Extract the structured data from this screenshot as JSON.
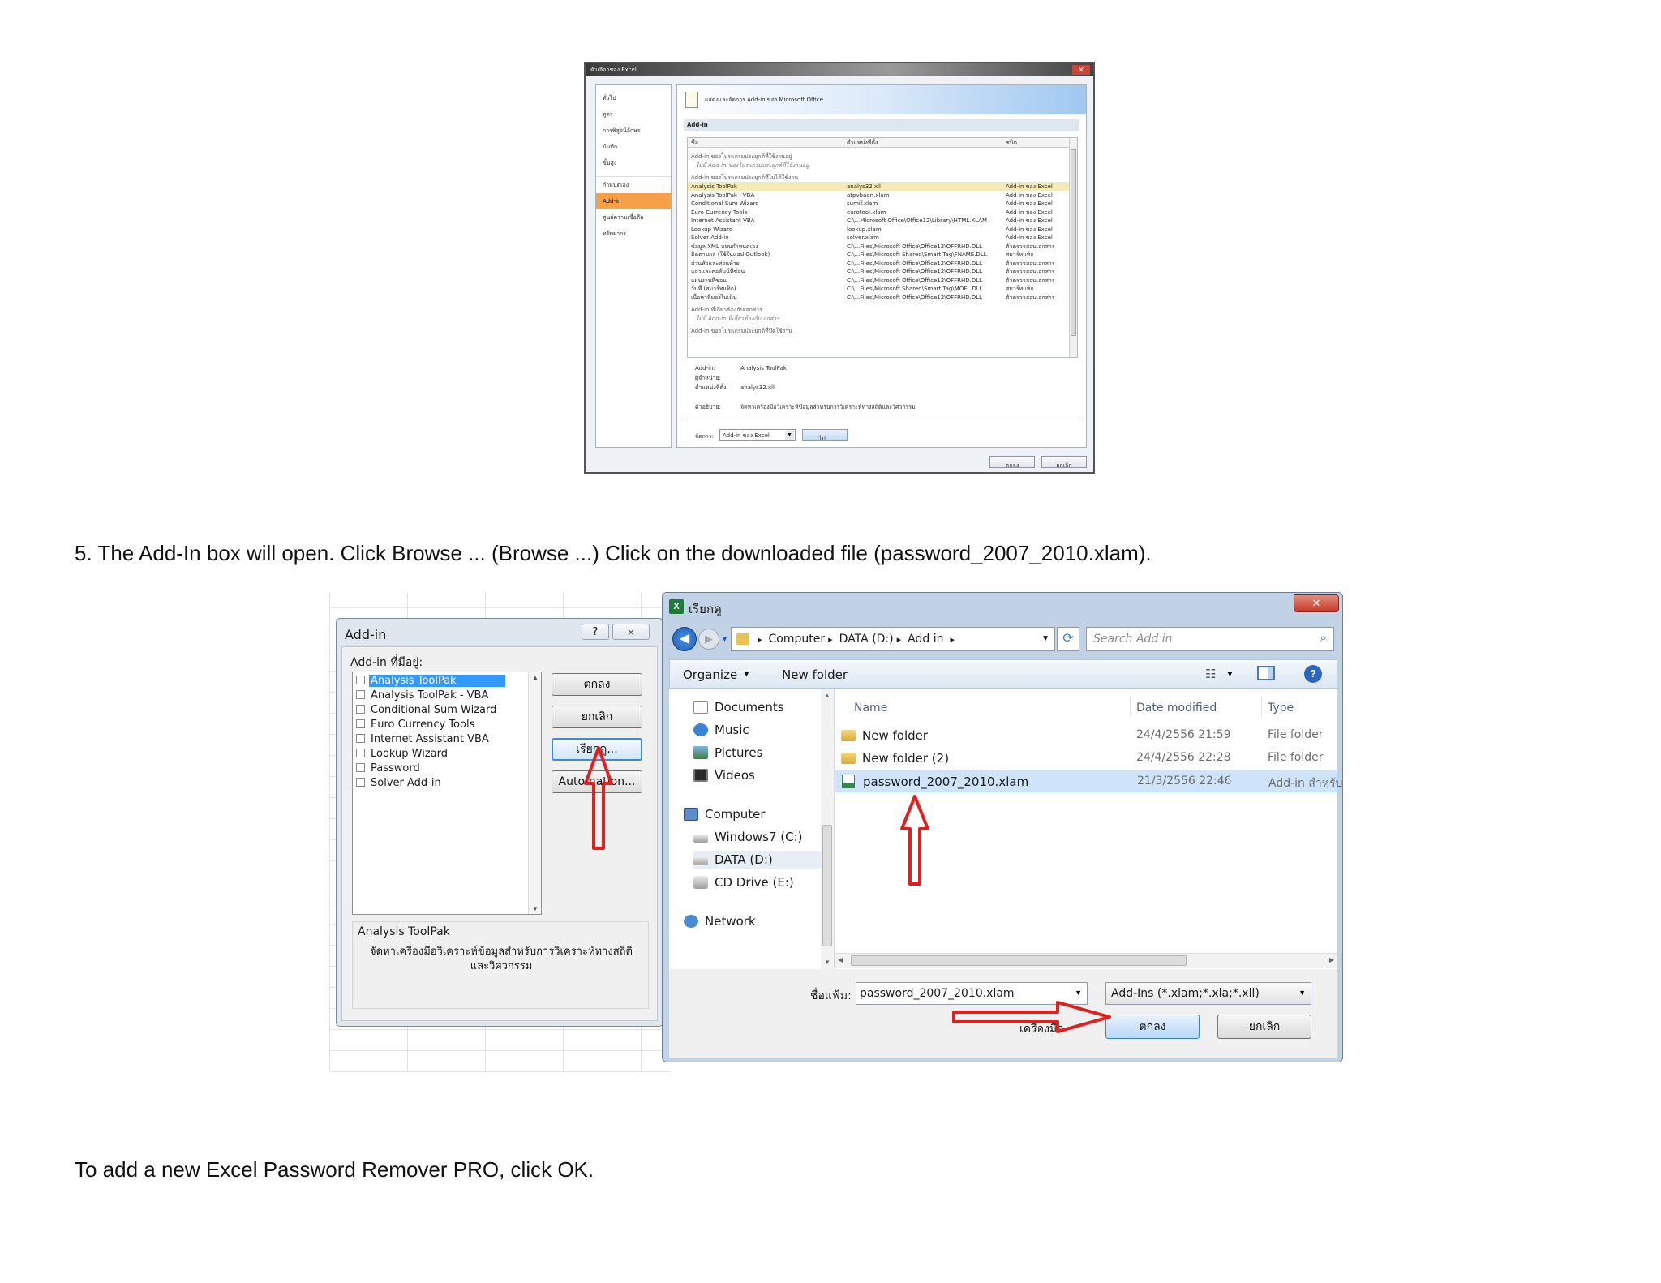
{
  "fig1": {
    "window_title": "ตัวเลือกของ Excel",
    "header_text": "แสดงและจัดการ Add-in ของ Microsoft Office",
    "section_title": "Add-in",
    "nav_items": [
      "ทั่วไป",
      "สูตร",
      "การพิสูจน์อักษร",
      "บันทึก",
      "ขั้นสูง",
      "กำหนดเอง",
      "Add-in",
      "ศูนย์ความเชื่อถือ",
      "ทรัพยากร"
    ],
    "col_headers": [
      "ชื่อ",
      "ตำแหน่งที่ตั้ง",
      "ชนิด"
    ],
    "groups": [
      {
        "title": "Add-in ของโปรแกรมประยุกต์ที่ใช้งานอยู่",
        "note": "ไม่มี Add-in ของโปรแกรมประยุกต์ที่ใช้งานอยู่",
        "rows": []
      },
      {
        "title": "Add-in ของโปรแกรมประยุกต์ที่ไม่ได้ใช้งาน",
        "note": "",
        "rows": [
          {
            "name": "Analysis ToolPak",
            "loc": "analys32.xll",
            "type": "Add-in ของ Excel"
          },
          {
            "name": "Analysis ToolPak - VBA",
            "loc": "atpvbaen.xlam",
            "type": "Add-in ของ Excel"
          },
          {
            "name": "Conditional Sum Wizard",
            "loc": "sumif.xlam",
            "type": "Add-in ของ Excel"
          },
          {
            "name": "Euro Currency Tools",
            "loc": "eurotool.xlam",
            "type": "Add-in ของ Excel"
          },
          {
            "name": "Internet Assistant VBA",
            "loc": "C:\\...Microsoft Office\\Office12\\Library\\HTML.XLAM",
            "type": "Add-in ของ Excel"
          },
          {
            "name": "Lookup Wizard",
            "loc": "lookup.xlam",
            "type": "Add-in ของ Excel"
          },
          {
            "name": "Solver Add-in",
            "loc": "solver.xlam",
            "type": "Add-in ของ Excel"
          },
          {
            "name": "ข้อมูล XML แบบกำหนดเอง",
            "loc": "C:\\...Files\\Microsoft Office\\Office12\\OFFRHD.DLL",
            "type": "ตัวตรวจสอบเอกสาร"
          },
          {
            "name": "ติดตามผล (ใช้ในแอป Outlook)",
            "loc": "C:\\...Files\\Microsoft Shared\\Smart Tag\\FNAME.DLL",
            "type": "สมาร์ทแท็ก"
          },
          {
            "name": "ส่วนหัวและส่วนท้าย",
            "loc": "C:\\...Files\\Microsoft Office\\Office12\\OFFRHD.DLL",
            "type": "ตัวตรวจสอบเอกสาร"
          },
          {
            "name": "แถวและคอลัมน์ที่ซ่อน",
            "loc": "C:\\...Files\\Microsoft Office\\Office12\\OFFRHD.DLL",
            "type": "ตัวตรวจสอบเอกสาร"
          },
          {
            "name": "แผ่นงานที่ซ่อน",
            "loc": "C:\\...Files\\Microsoft Office\\Office12\\OFFRHD.DLL",
            "type": "ตัวตรวจสอบเอกสาร"
          },
          {
            "name": "วันที่ (สมาร์ทแท็ก)",
            "loc": "C:\\...Files\\Microsoft Shared\\Smart Tag\\MOFL.DLL",
            "type": "สมาร์ทแท็ก"
          },
          {
            "name": "เนื้อหาที่มองไม่เห็น",
            "loc": "C:\\...Files\\Microsoft Office\\Office12\\OFFRHD.DLL",
            "type": "ตัวตรวจสอบเอกสาร"
          }
        ]
      },
      {
        "title": "Add-in ที่เกี่ยวข้องกับเอกสาร",
        "note": "ไม่มี Add-in ที่เกี่ยวข้องกับเอกสาร",
        "rows": []
      },
      {
        "title": "Add-in ของโปรแกรมประยุกต์ที่ปิดใช้งาน",
        "note": "",
        "rows": []
      }
    ],
    "details": [
      {
        "label": "Add-in:",
        "value": "Analysis ToolPak"
      },
      {
        "label": "ผู้จำหน่าย:",
        "value": ""
      },
      {
        "label": "ตำแหน่งที่ตั้ง:",
        "value": "analys32.xll"
      },
      {
        "label": "คำอธิบาย:",
        "value": "จัดหาเครื่องมือวิเคราะห์ข้อมูลสำหรับการวิเคราะห์ทางสถิติและวิศวกรรม"
      }
    ],
    "manage_label": "จัดการ:",
    "manage_value": "Add-in ของ Excel",
    "go_label": "ไป...",
    "ok_label": "ตกลง",
    "cancel_label": "ยกเลิก"
  },
  "step5_text": "5. The Add-In box will open. Click Browse ... (Browse ...) Click on the downloaded file (password_2007_2010.xlam).",
  "fig2": {
    "addin": {
      "title": "Add-in",
      "help_glyph": "?",
      "close_glyph": "✕",
      "list_label": "Add-in ที่มีอยู่:",
      "items": [
        "Analysis ToolPak",
        "Analysis ToolPak - VBA",
        "Conditional Sum Wizard",
        "Euro Currency Tools",
        "Internet Assistant VBA",
        "Lookup Wizard",
        "Password",
        "Solver Add-in"
      ],
      "ok": "ตกลง",
      "cancel": "ยกเลิก",
      "browse": "เรียกดู...",
      "automation": "Automation...",
      "desc_title": "Analysis ToolPak",
      "desc_text": "จัดหาเครื่องมือวิเคราะห์ข้อมูลสำหรับการวิเคราะห์ทางสถิติและวิศวกรรม"
    },
    "browse": {
      "title": "เรียกดู",
      "close_glyph": "✕",
      "breadcrumb": [
        "Computer",
        "DATA (D:)",
        "Add in"
      ],
      "search_placeholder": "Search Add in",
      "organize": "Organize",
      "new_folder": "New folder",
      "nav": [
        {
          "label": "Documents",
          "icon": "documents-icon",
          "indent": 1
        },
        {
          "label": "Music",
          "icon": "music-icon",
          "indent": 1
        },
        {
          "label": "Pictures",
          "icon": "pictures-icon",
          "indent": 1
        },
        {
          "label": "Videos",
          "icon": "videos-icon",
          "indent": 1
        },
        {
          "label": "Computer",
          "icon": "computer-icon",
          "indent": 0
        },
        {
          "label": "Windows7 (C:)",
          "icon": "drive-icon",
          "indent": 1
        },
        {
          "label": "DATA (D:)",
          "icon": "drive-icon",
          "indent": 1
        },
        {
          "label": "CD Drive (E:)",
          "icon": "cd-drive-icon",
          "indent": 1
        },
        {
          "label": "Network",
          "icon": "network-icon",
          "indent": 0
        }
      ],
      "columns": [
        "Name",
        "Date modified",
        "Type"
      ],
      "files": [
        {
          "name": "New folder",
          "date": "24/4/2556 21:59",
          "type": "File folder"
        },
        {
          "name": "New folder (2)",
          "date": "24/4/2556 22:28",
          "type": "File folder"
        },
        {
          "name": "password_2007_2010.xlam",
          "date": "21/3/2556 22:46",
          "type": "Add-in สำหรับ"
        }
      ],
      "filename_label": "ชื่อแฟ้ม:",
      "filename_value": "password_2007_2010.xlam",
      "filter_value": "Add-Ins (*.xlam;*.xla;*.xll)",
      "tools": "เครื่องมือ",
      "ok": "ตกลง",
      "cancel": "ยกเลิก"
    }
  },
  "closing_text": "To add a new Excel Password Remover PRO, click OK.",
  "colors": {
    "accent": "#f7a04a",
    "arrow": "#e0201e",
    "select": "#cfe3fb",
    "titlebar": "#c9d8ea"
  }
}
